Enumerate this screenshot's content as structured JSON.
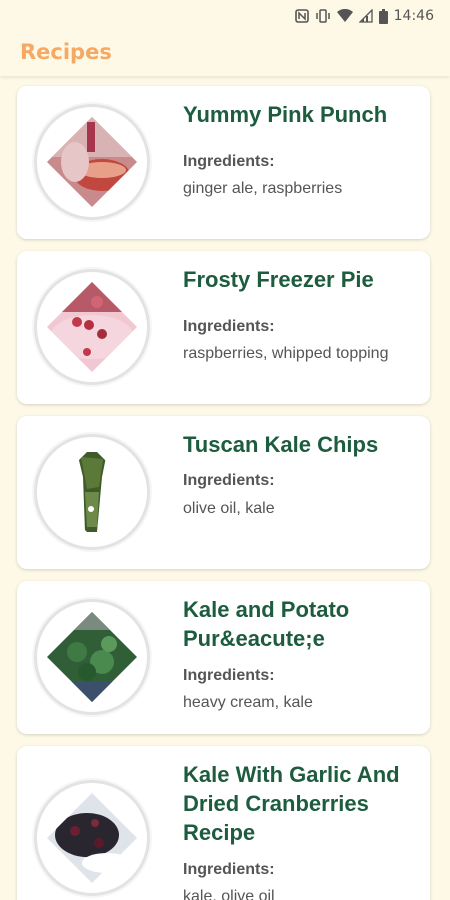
{
  "status_bar": {
    "time": "14:46",
    "icons": [
      "nfc-icon",
      "vibrate-icon",
      "wifi-icon",
      "signal-icon",
      "battery-icon"
    ]
  },
  "app_bar": {
    "title": "Recipes"
  },
  "recipes": [
    {
      "title": "Yummy Pink Punch",
      "ingredients_label": "Ingredients:",
      "ingredients": "ginger ale, raspberries",
      "image_icon": "pink-punch-photo"
    },
    {
      "title": "Frosty Freezer Pie",
      "ingredients_label": "Ingredients:",
      "ingredients": "raspberries, whipped topping",
      "image_icon": "freezer-pie-photo"
    },
    {
      "title": "Tuscan Kale Chips",
      "ingredients_label": "Ingredients:",
      "ingredients": "olive oil, kale",
      "image_icon": "kale-chips-photo"
    },
    {
      "title": "Kale and Potato Pur&eacute;e",
      "ingredients_label": "Ingredients:",
      "ingredients": "heavy cream, kale",
      "image_icon": "kale-puree-photo"
    },
    {
      "title": "Kale With Garlic And Dried Cranberries Recipe",
      "ingredients_label": "Ingredients:",
      "ingredients": "kale, olive oil",
      "image_icon": "kale-cranberries-photo"
    }
  ],
  "colors": {
    "background": "#fdf9e6",
    "title_accent": "#f5a962",
    "recipe_title": "#1d5c3f",
    "text_secondary": "#555555"
  }
}
